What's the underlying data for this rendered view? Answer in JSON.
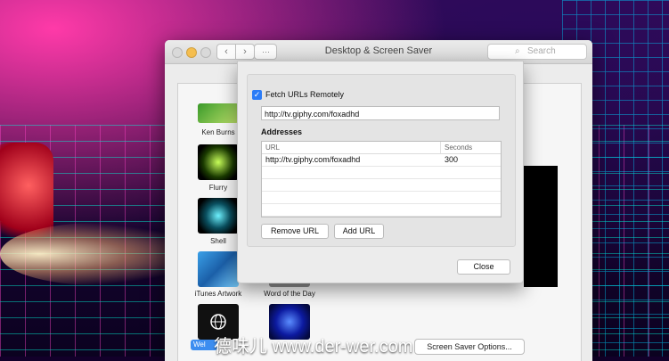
{
  "window": {
    "title": "Desktop & Screen Saver",
    "search_placeholder": "Search"
  },
  "toolbar": {
    "back_glyph": "‹",
    "forward_glyph": "›",
    "grid_glyph": "⋯"
  },
  "screensavers": [
    {
      "label": "Ken Burns",
      "icon": "ken-burns-thumbnail"
    },
    {
      "label": "Flurry",
      "icon": "flurry-thumbnail"
    },
    {
      "label": "Shell",
      "icon": "shell-thumbnail"
    },
    {
      "label": "iTunes Artwork",
      "icon": "itunes-artwork-thumbnail"
    },
    {
      "label": "Word of the Day",
      "icon": "word-of-the-day-thumbnail"
    },
    {
      "label": "Wel",
      "icon": "globe-thumbnail"
    }
  ],
  "main": {
    "screen_saver_options_label": "Screen Saver Options..."
  },
  "sheet": {
    "fetch_label": "Fetch URLs Remotely",
    "fetch_checked": true,
    "fetch_url": "http://tv.giphy.com/foxadhd",
    "addresses_heading": "Addresses",
    "table": {
      "columns": [
        "URL",
        "Seconds"
      ],
      "rows": [
        {
          "url": "http://tv.giphy.com/foxadhd",
          "seconds": "300"
        }
      ]
    },
    "remove_label": "Remove URL",
    "add_label": "Add URL",
    "close_label": "Close"
  },
  "watermark": "德味儿 www.der-wer.com",
  "colors": {
    "accent": "#2b7cf7",
    "minimize_light": "#f5be4f"
  }
}
